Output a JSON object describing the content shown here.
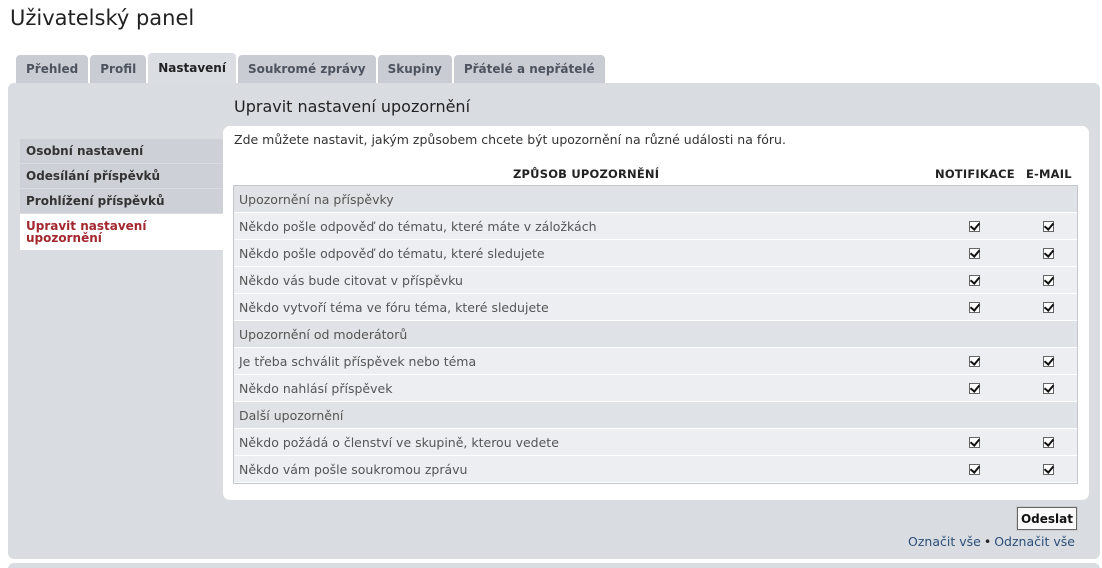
{
  "page": {
    "title": "Uživatelský panel"
  },
  "tabs": [
    {
      "label": "Přehled",
      "active": false
    },
    {
      "label": "Profil",
      "active": false
    },
    {
      "label": "Nastavení",
      "active": true
    },
    {
      "label": "Soukromé zprávy",
      "active": false
    },
    {
      "label": "Skupiny",
      "active": false
    },
    {
      "label": "Přátelé a nepřátelé",
      "active": false
    }
  ],
  "sidebar": {
    "items": [
      {
        "label": "Osobní nastavení"
      },
      {
        "label": "Odesílání příspěvků"
      },
      {
        "label": "Prohlížení příspěvků"
      },
      {
        "label": "Upravit nastavení upozornění",
        "active": true
      }
    ]
  },
  "main": {
    "title": "Upravit nastavení upozornění",
    "intro": "Zde můžete nastavit, jakým způsobem chcete být upozornění na různé události na fóru.",
    "columns": {
      "method": "ZPŮSOB UPOZORNĚNÍ",
      "notification": "NOTIFIKACE",
      "email": "E-MAIL"
    },
    "rows": [
      {
        "type": "group",
        "label": "Upozornění na příspěvky"
      },
      {
        "type": "item",
        "label": "Někdo pošle odpověď do tématu, které máte v záložkách",
        "notification": true,
        "email": true
      },
      {
        "type": "item",
        "label": "Někdo pošle odpověď do tématu, které sledujete",
        "notification": true,
        "email": true
      },
      {
        "type": "item",
        "label": "Někdo vás bude citovat v příspěvku",
        "notification": true,
        "email": true
      },
      {
        "type": "item",
        "label": "Někdo vytvoří téma ve fóru téma, které sledujete",
        "notification": true,
        "email": true
      },
      {
        "type": "group",
        "label": "Upozornění od moderátorů"
      },
      {
        "type": "item",
        "label": "Je třeba schválit příspěvek nebo téma",
        "notification": true,
        "email": true
      },
      {
        "type": "item",
        "label": "Někdo nahlásí příspěvek",
        "notification": true,
        "email": true
      },
      {
        "type": "group",
        "label": "Další upozornění"
      },
      {
        "type": "item",
        "label": "Někdo požádá o členství ve skupině, kterou vedete",
        "notification": true,
        "email": true
      },
      {
        "type": "item",
        "label": "Někdo vám pošle soukromou zprávu",
        "notification": true,
        "email": true
      }
    ]
  },
  "actions": {
    "submit_label": "Odeslat",
    "mark_all": "Označit vše",
    "separator": "•",
    "unmark_all": "Odznačit vše"
  },
  "colors": {
    "panel": "#d9dde2",
    "active_menu_text": "#a3272e",
    "link": "#2c4e78"
  }
}
